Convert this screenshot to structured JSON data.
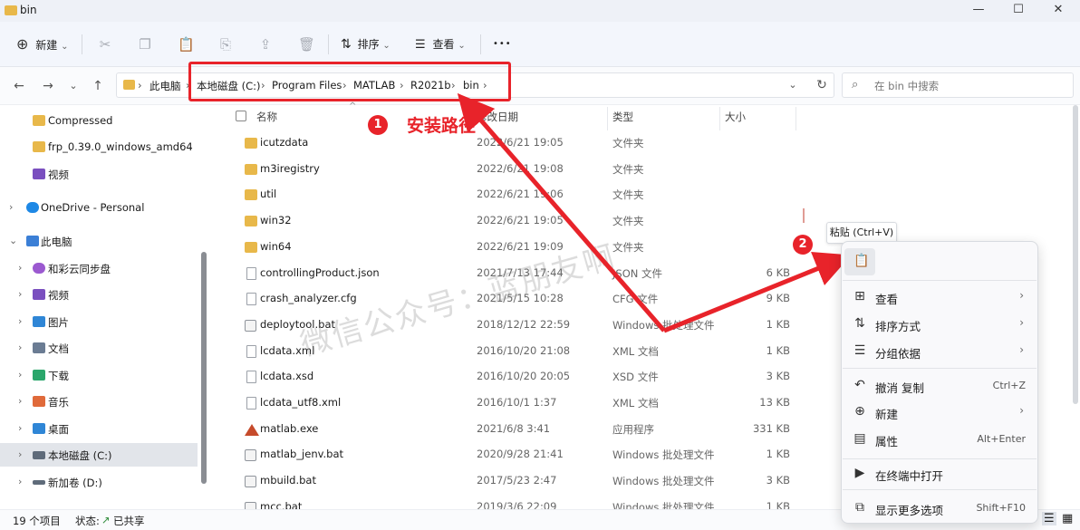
{
  "window": {
    "title": "bin",
    "min_glyph": "—",
    "max_glyph": "☐",
    "close_glyph": "✕"
  },
  "toolbar": {
    "new_label": "新建",
    "sort_label": "排序",
    "view_label": "查看",
    "more_glyph": "•••",
    "new_glyph": "⊕",
    "sort_glyph": "⇅",
    "view_glyph": "☰",
    "dropdown_glyph": "⌄",
    "cut_glyph": "✂",
    "copy_glyph": "❐",
    "paste_glyph": "📋",
    "rename_glyph": "⎘",
    "share_glyph": "⇪",
    "delete_glyph": "🗑"
  },
  "nav": {
    "back_glyph": "←",
    "forward_glyph": "→",
    "recent_glyph": "⌄",
    "up_glyph": "↑",
    "expand_glyph": "⌄",
    "refresh_glyph": "↻",
    "search_glyph": "⌕"
  },
  "breadcrumb": {
    "sep": "›",
    "items": [
      "此电脑",
      "本地磁盘 (C:)",
      "Program Files",
      "MATLAB",
      "R2021b",
      "bin"
    ]
  },
  "search": {
    "placeholder": "在 bin 中搜索"
  },
  "sidebar": {
    "chevron_right": "›",
    "chevron_down": "⌄",
    "items": [
      {
        "label": "Compressed",
        "color": "#e8b84a"
      },
      {
        "label": "frp_0.39.0_windows_amd64",
        "color": "#e8b84a"
      },
      {
        "label": "视频",
        "color": "#7a4fbf"
      },
      {
        "label": "OneDrive - Personal",
        "color": "#1e88e5"
      },
      {
        "label": "此电脑",
        "color": "#3b7fd6"
      },
      {
        "label": "和彩云同步盘",
        "color": "#9b59d0"
      },
      {
        "label": "视频",
        "color": "#7a4fbf"
      },
      {
        "label": "图片",
        "color": "#2f86d6"
      },
      {
        "label": "文档",
        "color": "#6b7c93"
      },
      {
        "label": "下载",
        "color": "#2aa66b"
      },
      {
        "label": "音乐",
        "color": "#e06a3a"
      },
      {
        "label": "桌面",
        "color": "#2f86d6"
      },
      {
        "label": "本地磁盘 (C:)",
        "color": "#5f6b7a"
      },
      {
        "label": "新加卷 (D:)",
        "color": "#5f6b7a"
      }
    ]
  },
  "columns": {
    "name": "名称",
    "date": "修改日期",
    "type": "类型",
    "size": "大小",
    "sort_glyph": "^"
  },
  "files": [
    {
      "name": "icutzdata",
      "date": "2022/6/21 19:05",
      "type": "文件夹",
      "size": "",
      "kind": "folder"
    },
    {
      "name": "m3iregistry",
      "date": "2022/6/21 19:08",
      "type": "文件夹",
      "size": "",
      "kind": "folder"
    },
    {
      "name": "util",
      "date": "2022/6/21 19:06",
      "type": "文件夹",
      "size": "",
      "kind": "folder"
    },
    {
      "name": "win32",
      "date": "2022/6/21 19:05",
      "type": "文件夹",
      "size": "",
      "kind": "folder"
    },
    {
      "name": "win64",
      "date": "2022/6/21 19:09",
      "type": "文件夹",
      "size": "",
      "kind": "folder"
    },
    {
      "name": "controllingProduct.json",
      "date": "2021/7/13 17:44",
      "type": "JSON 文件",
      "size": "6 KB",
      "kind": "file"
    },
    {
      "name": "crash_analyzer.cfg",
      "date": "2021/5/15 10:28",
      "type": "CFG 文件",
      "size": "9 KB",
      "kind": "file"
    },
    {
      "name": "deploytool.bat",
      "date": "2018/12/12 22:59",
      "type": "Windows 批处理文件",
      "size": "1 KB",
      "kind": "bat"
    },
    {
      "name": "lcdata.xml",
      "date": "2016/10/20 21:08",
      "type": "XML 文档",
      "size": "1 KB",
      "kind": "file"
    },
    {
      "name": "lcdata.xsd",
      "date": "2016/10/20 20:05",
      "type": "XSD 文件",
      "size": "3 KB",
      "kind": "file"
    },
    {
      "name": "lcdata_utf8.xml",
      "date": "2016/10/1 1:37",
      "type": "XML 文档",
      "size": "13 KB",
      "kind": "file"
    },
    {
      "name": "matlab.exe",
      "date": "2021/6/8 3:41",
      "type": "应用程序",
      "size": "331 KB",
      "kind": "exe"
    },
    {
      "name": "matlab_jenv.bat",
      "date": "2020/9/28 21:41",
      "type": "Windows 批处理文件",
      "size": "1 KB",
      "kind": "bat"
    },
    {
      "name": "mbuild.bat",
      "date": "2017/5/23 2:47",
      "type": "Windows 批处理文件",
      "size": "3 KB",
      "kind": "bat"
    },
    {
      "name": "mcc.bat",
      "date": "2019/3/6 22:09",
      "type": "Windows 批处理文件",
      "size": "1 KB",
      "kind": "bat"
    }
  ],
  "status": {
    "count": "19 个项目",
    "state_label": "状态:",
    "state_value": "已共享",
    "list_view_glyph": "☰",
    "tile_view_glyph": "▦"
  },
  "annotations": {
    "badge1": "1",
    "badge2": "2",
    "label1": "安装路径",
    "watermark": "微信公众号：蓝朋友啊",
    "color": "#e8232a"
  },
  "context_menu": {
    "tooltip": "粘贴 (Ctrl+V)",
    "paste_glyph": "📋",
    "arrow_glyph": "›",
    "items": [
      {
        "label": "查看",
        "glyph": "⊞",
        "shortcut": "",
        "submenu": true
      },
      {
        "label": "排序方式",
        "glyph": "⇅",
        "shortcut": "",
        "submenu": true
      },
      {
        "label": "分组依据",
        "glyph": "☰",
        "shortcut": "",
        "submenu": true
      },
      {
        "label": "撤消 复制",
        "glyph": "↶",
        "shortcut": "Ctrl+Z",
        "submenu": false
      },
      {
        "label": "新建",
        "glyph": "⊕",
        "shortcut": "",
        "submenu": true
      },
      {
        "label": "属性",
        "glyph": "▤",
        "shortcut": "Alt+Enter",
        "submenu": false
      },
      {
        "label": "在终端中打开",
        "glyph": "▶",
        "shortcut": "",
        "submenu": false
      },
      {
        "label": "显示更多选项",
        "glyph": "⧉",
        "shortcut": "Shift+F10",
        "submenu": false
      }
    ]
  }
}
